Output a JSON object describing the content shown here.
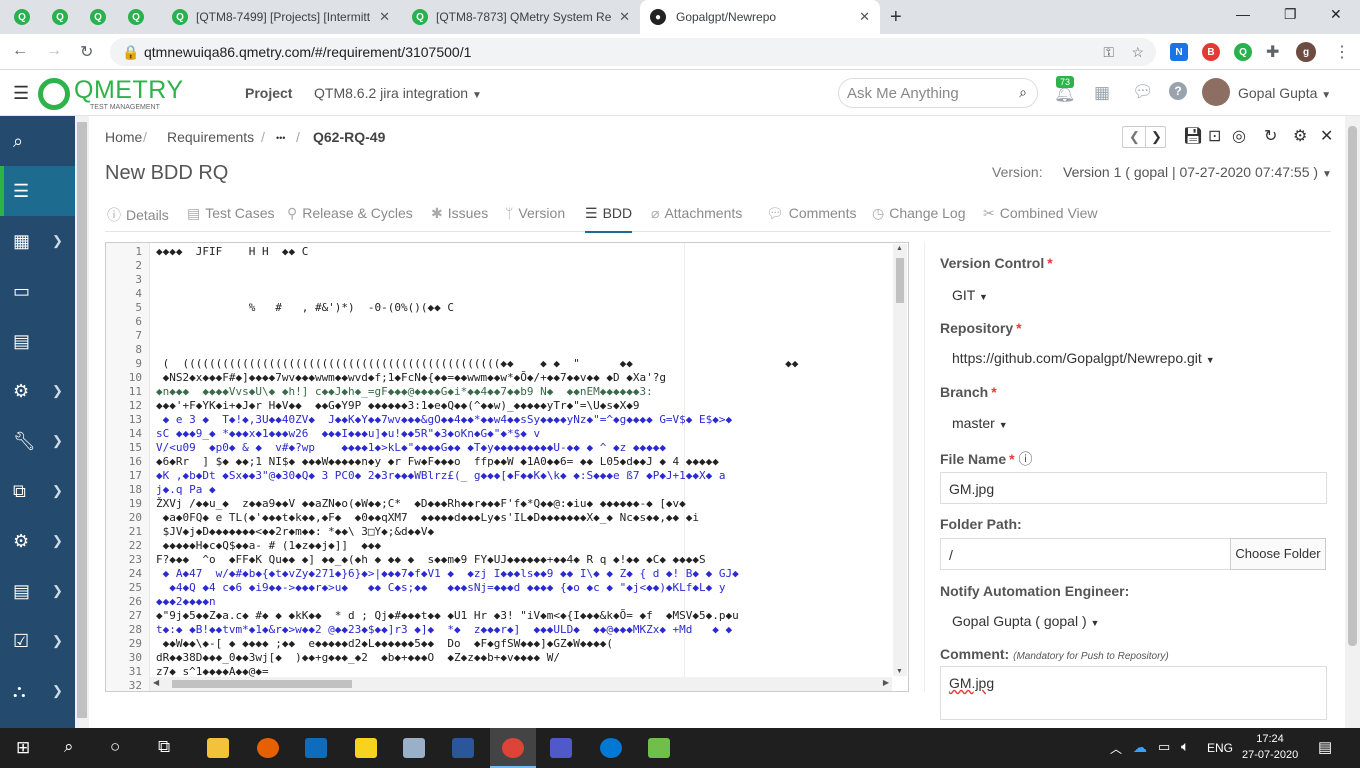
{
  "browser": {
    "tabs": [
      {
        "title": ""
      },
      {
        "title": ""
      },
      {
        "title": ""
      },
      {
        "title": ""
      },
      {
        "title": "[QTM8-7499] [Projects] [Intermitt"
      },
      {
        "title": "[QTM8-7873] QMetry System Rep"
      },
      {
        "title": "Gopalgpt/Newrepo"
      }
    ],
    "new_tab": "+",
    "url": "qtmnewuiqa86.qmetry.com/#/requirement/3107500/1",
    "ext_badge": "B",
    "profile_initial": "g"
  },
  "app": {
    "logo_text": "QMETRY",
    "logo_sub": "TEST MANAGEMENT",
    "project_label": "Project",
    "project_name": "QTM8.6.2 jira integration",
    "search_placeholder": "Ask Me Anything",
    "notification_count": "73",
    "user_name": "Gopal Gupta"
  },
  "breadcrumb": [
    "Home",
    "Requirements",
    "•••",
    "Q62-RQ-49"
  ],
  "page_title": "New BDD RQ",
  "version": {
    "label": "Version:",
    "value": "Version 1 ( gopal | 07-27-2020 07:47:55 )"
  },
  "tabs": [
    "Details",
    "Test Cases",
    "Release & Cycles",
    "Issues",
    "Version",
    "BDD",
    "Attachments",
    "Comments",
    "Change Log",
    "Combined View"
  ],
  "active_tab": "BDD",
  "editor": {
    "line_numbers": [
      "1",
      "2",
      "3",
      "4",
      "5",
      "6",
      "7",
      "8",
      "9",
      "10",
      "11",
      "12",
      "13",
      "14",
      "15",
      "16",
      "17",
      "18",
      "19",
      "20",
      "21",
      "22",
      "23",
      "24",
      "25",
      "26",
      "27",
      "28",
      "29",
      "30",
      "31",
      "32"
    ],
    "lines": [
      "◆◆◆◆  JFIF    H H  ◆◆ C",
      "",
      "",
      "",
      "              %   #   , #&')*)  -0-(0%()(◆◆ C",
      "",
      "",
      "",
      " (  ((((((((((((((((((((((((((((((((((((((((((((((((◆◆    ◆ ◆  \"      ◆◆                       ◆◆",
      " ◆NS2◆x◆◆◆F#◆]◆◆◆◆7wv◆◆◆wwm◆◆wvd◆f;1◆FcN◆{◆◆=◆◆wwm◆◆w*◆Õ◆/+◆◆7◆◆v◆◆ ◆D ◆Xa'?g",
      "◆n◆◆◆  ◆◆◆◆Vvs◆U\\◆ ◆h!] c◆◆J◆h◆_=gF◆◆◆@◆◆◆◆G◆i*◆◆4◆◆7◆◆b9 N◆  ◆◆nEM◆◆◆◆◆◆3:",
      "◆◆◆'+F◆YK◆i+◆J◆r H◆V◆◆  ◆◆G◆Y9P ◆◆◆◆◆◆3:1◆e◆Q◆◆(^◆◆w)_◆◆◆◆◆yTr◆\"=\\U◆s◆X◆9",
      " ◆ e 3 ◆  T◆!◆,3U◆◆40ZV◆  J◆◆K◆Y◆◆7wv◆◆◆&gO◆◆4◆◆*◆◆w4◆◆sSy◆◆◆◆yNz◆\"=^◆g◆◆◆◆ G=V$◆ E$◆>◆",
      "sC ◆◆◆9_◆ *◆◆◆x◆1◆◆◆w26  ◆◆◆I◆◆◆u]◆u!◆◆5R\"◆3◆oKn◆G◆\"◆*$◆ v",
      "V/<u09  ◆p0◆ & ◆  v#◆?wp    ◆◆◆◆1◆>kL◆\"◆◆◆◆G◆◆ ◆T◆y◆◆◆◆◆◆◆◆◆U-◆◆ ◆ ^ ◆z ◆◆◆◆◆",
      "◆6◆Rr  ] $◆ ◆◆;1 NI$◆ ◆◆◆W◆◆◆◆◆n◆y ◆r Fw◆F◆◆◆o  ffp◆◆W ◆1A0◆◆6= ◆◆ L05◆d◆◆J ◆ 4 ◆◆◆◆◆",
      "◆K ,◆b◆Dt ◆Sx◆◆3\"@◆30◆Q◆ 3 PC0◆ 2◆3r◆◆◆WBlrz£(_ g◆◆◆[◆F◆◆K◆\\k◆ ◆:S◆◆◆e ß7 ◆P◆J+1◆◆X◆ a",
      "j◆.q Pa ◆",
      "ŽXVj /◆◆u_◆  z◆◆a9◆◆V ◆◆aZN◆o(◆W◆◆;C*  ◆D◆◆◆Rh◆◆r◆◆◆F'f◆*Q◆◆@:◆iu◆ ◆◆◆◆◆◆-◆ [◆v◆",
      " ◆a◆0FQ◆ e TL(◆'◆◆◆t◆k◆◆,◆F◆  ◆0◆◆qXM7  ◆◆◆◆◆d◆◆◆Ly◆s'IL◆D◆◆◆◆◆◆◆X◆_◆ Nc◆s◆◆,◆◆ ◆i",
      " $JV◆j◆D◆◆◆◆◆◆◆<◆◆2r◆m◆◆: *◆◆\\ 3□Y◆;&d◆◆V◆",
      " ◆◆◆◆◆H◆c◆Q$◆◆a- # (1◆z◆◆j◆]]  ◆◆◆",
      "F?◆◆◆  ^o  ◆FF◆K Qu◆◆ ◆] ◆◆_◆(◆h ◆ ◆◆ ◆  s◆◆m◆9 FY◆UJ◆◆◆◆◆◆+◆◆4◆ R q ◆!◆◆ ◆C◆ ◆◆◆◆S",
      " ◆ A◆47  w/◆#◆b◆{◆t◆vZy◆271◆}6}◆>|◆◆◆7◆f◆V1 ◆  ◆zj I◆◆◆ls◆◆9 ◆◆ I\\◆ ◆ Z◆ { d ◆! B◆ ◆ GJ◆",
      "  ◆4◆Q ◆4 c◆6 ◆i9◆◆->◆◆◆r◆>u◆   ◆◆ C◆s;◆◆   ◆◆◆sNj=◆◆◆d ◆◆◆◆ {◆o ◆c ◆ \"◆j<◆◆)◆KLf◆L◆ y",
      "◆◆◆2◆◆◆◆n",
      "◆\"9j◆5◆◆Z◆a.c◆ #◆ ◆ ◆kK◆◆  * d ; Qj◆#◆◆◆t◆◆ ◆U1 Hr ◆3! \"iV◆m<◆{I◆◆◆&k◆Õ= ◆f  ◆MSV◆5◆.p◆u",
      "t◆:◆ ◆B!◆◆tvm*◆1◆&r◆>w◆◆2 @◆◆23◆$◆◆]r3 ◆]◆  *◆  z◆◆◆r◆]  ◆◆◆ULD◆  ◆◆@◆◆◆MKZx◆ +Md   ◆ ◆",
      " ◆◆W◆◆\\◆-[ ◆ ◆◆◆◆ ;◆◆  e◆◆◆◆◆d2◆L◆◆◆◆◆◆5◆◆  Do  ◆F◆gfSW◆◆◆]◆GZ◆W◆◆◆◆(",
      "dR◆◆38D◆◆◆_0◆◆3wj[◆  )◆◆+g◆◆◆_◆2  ◆b◆+◆◆◆O  ◆Z◆z◆◆b+◆v◆◆◆◆ W/",
      "z7◆ s^1◆◆◆◆A◆◆@◆="
    ]
  },
  "form": {
    "version_control": {
      "label": "Version Control",
      "value": "GIT"
    },
    "repository": {
      "label": "Repository",
      "value": "https://github.com/Gopalgpt/Newrepo.git"
    },
    "branch": {
      "label": "Branch",
      "value": "master"
    },
    "file_name": {
      "label": "File Name",
      "value": "GM.jpg"
    },
    "folder_path": {
      "label": "Folder Path:",
      "value": "/",
      "button": "Choose Folder"
    },
    "notify": {
      "label": "Notify Automation Engineer:",
      "value": "Gopal Gupta ( gopal )"
    },
    "comment": {
      "label": "Comment:",
      "hint": "(Mandatory for Push to Repository)",
      "value": "GM.jpg"
    },
    "required_mark": "*"
  },
  "taskbar": {
    "time": "17:24",
    "date": "27-07-2020",
    "lang": "ENG"
  }
}
